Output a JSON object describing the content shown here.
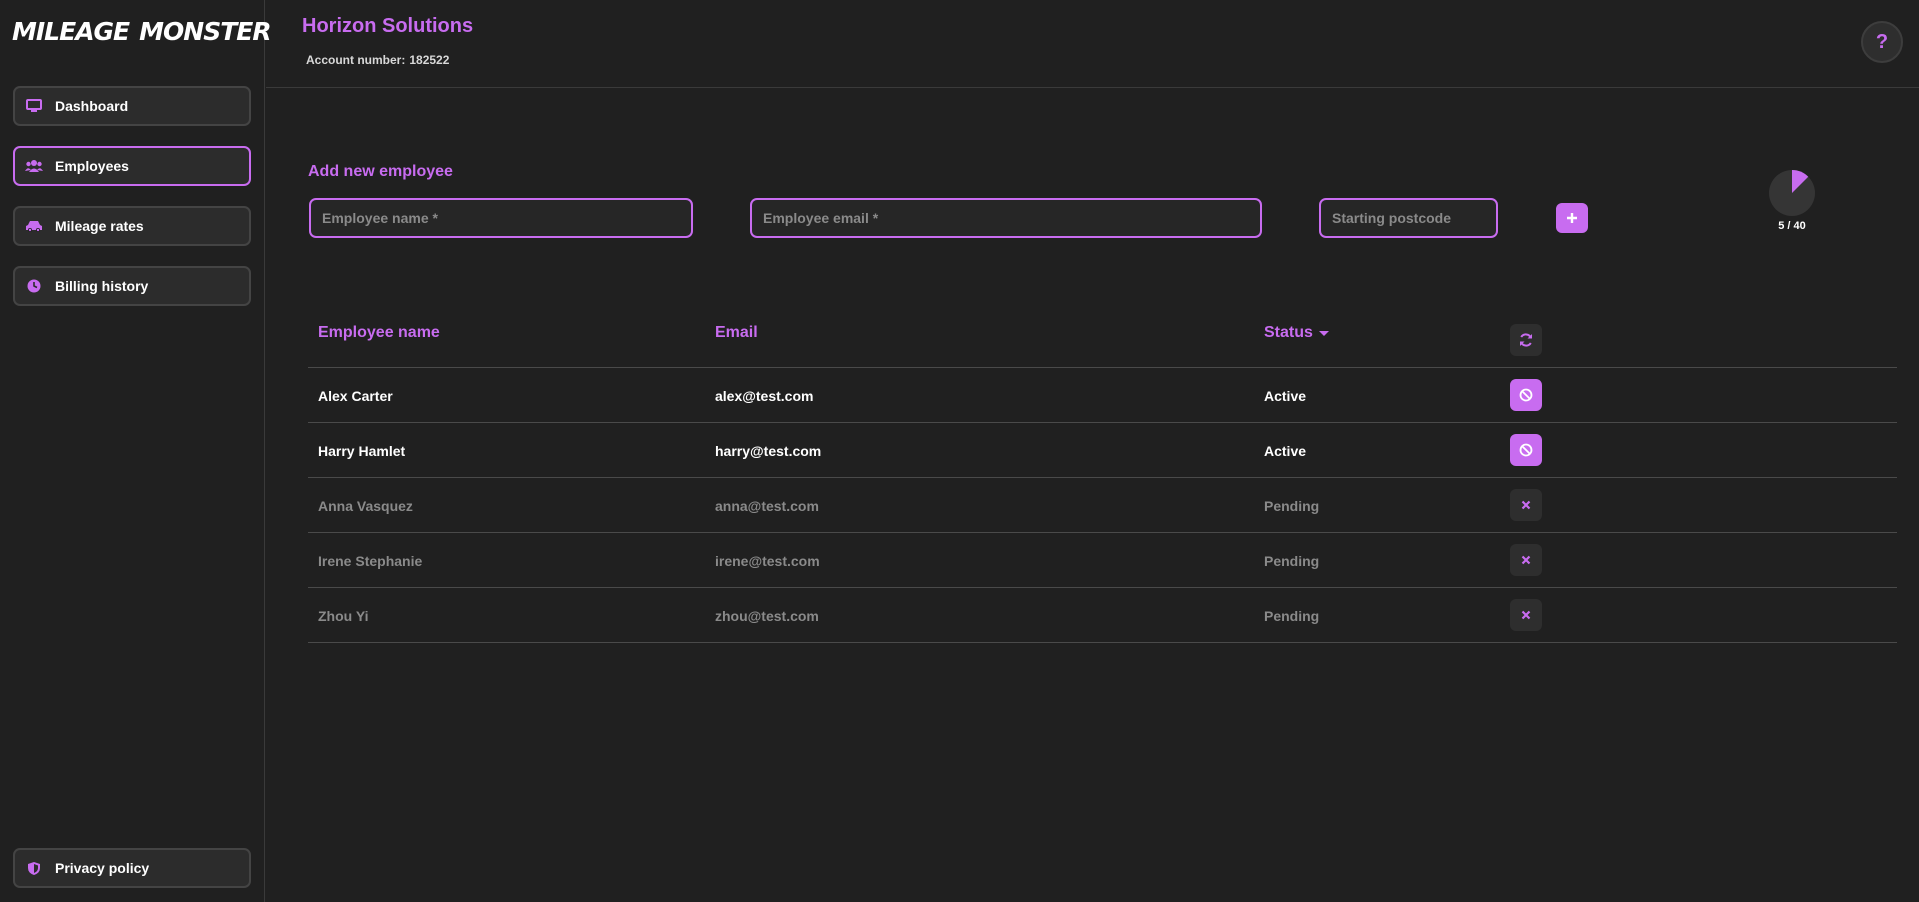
{
  "brand": {
    "word_left": "Mileage",
    "word_right": "Monster",
    "accent": "#c86cf0"
  },
  "sidebar": {
    "items": [
      {
        "label": "Dashboard",
        "icon": "monitor-icon"
      },
      {
        "label": "Employees",
        "icon": "users-icon",
        "active": true
      },
      {
        "label": "Mileage rates",
        "icon": "car-icon"
      },
      {
        "label": "Billing history",
        "icon": "clock-icon"
      }
    ],
    "footer_item": {
      "label": "Privacy policy",
      "icon": "shield-icon"
    }
  },
  "header": {
    "company": "Horizon Solutions",
    "account_label": "Account number:",
    "account_number": "182522",
    "help_icon": "?"
  },
  "add_employee": {
    "title": "Add new employee",
    "name_placeholder": "Employee name *",
    "email_placeholder": "Employee email *",
    "postcode_placeholder": "Starting postcode",
    "add_button": "+"
  },
  "usage": {
    "used": 5,
    "total": 40,
    "label": "5 / 40"
  },
  "table": {
    "headers": {
      "name": "Employee name",
      "email": "Email",
      "status": "Status"
    },
    "rows": [
      {
        "name": "Alex Carter",
        "email": "alex@test.com",
        "status": "Active"
      },
      {
        "name": "Harry Hamlet",
        "email": "harry@test.com",
        "status": "Active"
      },
      {
        "name": "Anna Vasquez",
        "email": "anna@test.com",
        "status": "Pending"
      },
      {
        "name": "Irene Stephanie",
        "email": "irene@test.com",
        "status": "Pending"
      },
      {
        "name": "Zhou Yi",
        "email": "zhou@test.com",
        "status": "Pending"
      }
    ]
  }
}
